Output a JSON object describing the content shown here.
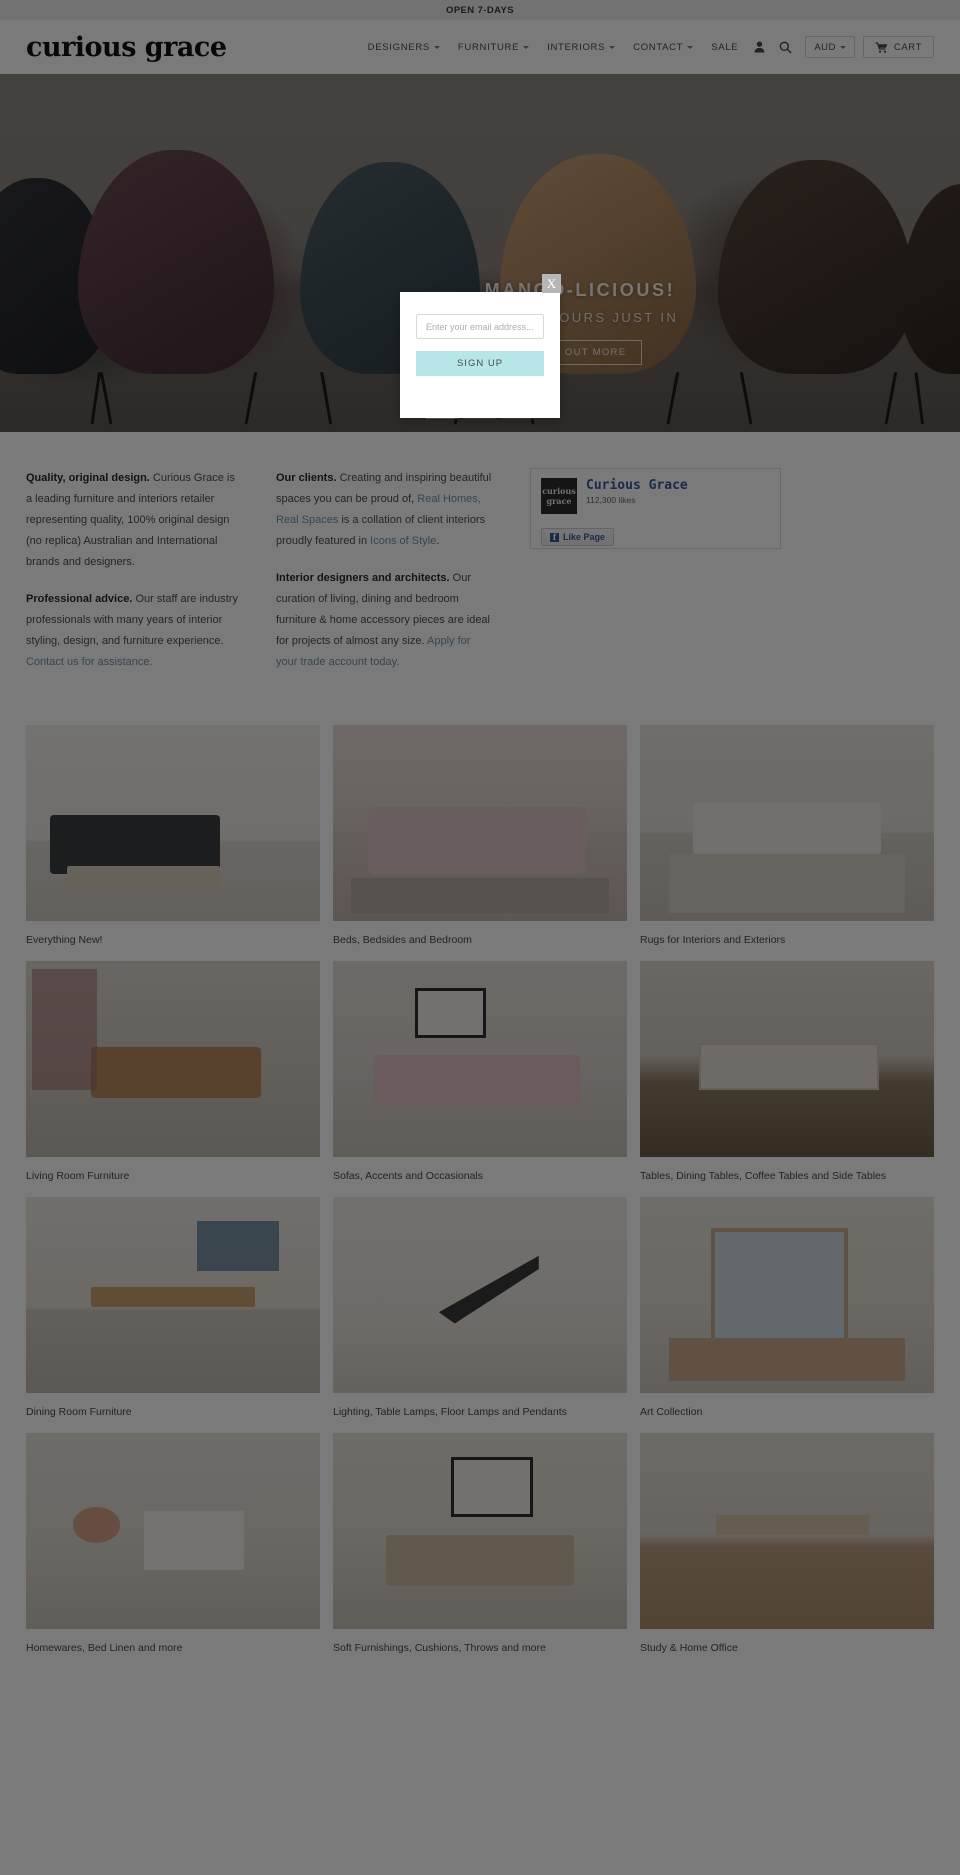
{
  "announcement": {
    "text": "OPEN 7-DAYS"
  },
  "header": {
    "logo": "curious grace",
    "nav": [
      {
        "label": "DESIGNERS",
        "has_dropdown": true
      },
      {
        "label": "FURNITURE",
        "has_dropdown": true
      },
      {
        "label": "INTERIORS",
        "has_dropdown": true
      },
      {
        "label": "CONTACT",
        "has_dropdown": true
      },
      {
        "label": "SALE",
        "has_dropdown": false
      }
    ],
    "account_icon": "user-icon",
    "search_icon": "search-icon",
    "currency": "AUD",
    "cart_label": "CART",
    "cart_icon": "cart-icon"
  },
  "hero": {
    "title": "MANGO-LICIOUS!",
    "subtitle": "NEW COLOURS JUST IN",
    "cta": "FIND OUT MORE",
    "slides": 3,
    "active_slide": 1
  },
  "intro": {
    "col1": {
      "p1_bold": "Quality, original design.",
      "p1_text": " Curious Grace is a leading furniture and interiors retailer representing quality, 100% original design (no replica) Australian and International brands and designers.",
      "p2_bold": "Professional advice.",
      "p2_text": " Our staff are industry professionals with many years of interior styling, design, and furniture experience. ",
      "p2_link": "Contact us for assistance."
    },
    "col2": {
      "p1_bold": "Our clients.",
      "p1_text_a": " Creating and inspiring beautiful spaces you can be proud of, ",
      "p1_link_a": "Real Homes, Real Spaces",
      "p1_text_b": " is a collation of client interiors proudly featured in ",
      "p1_link_b": "Icons of Style",
      "p1_text_c": ".",
      "p2_bold": "Interior designers and architects.",
      "p2_text": " Our curation of living, dining and bedroom furniture & home accessory pieces are ideal for projects of almost any size. ",
      "p2_link": "Apply for your trade account today."
    }
  },
  "facebook": {
    "page_name": "Curious Grace",
    "likes": "112,300 likes",
    "like_button": "Like Page",
    "logo_line1": "curious",
    "logo_line2": "grace",
    "brand_color": "#3b5998"
  },
  "categories": [
    {
      "label": "Everything New!"
    },
    {
      "label": "Beds, Bedsides and Bedroom"
    },
    {
      "label": "Rugs for Interiors and Exteriors"
    },
    {
      "label": "Living Room Furniture"
    },
    {
      "label": "Sofas, Accents and Occasionals"
    },
    {
      "label": "Tables, Dining Tables, Coffee Tables and Side Tables"
    },
    {
      "label": "Dining Room Furniture"
    },
    {
      "label": "Lighting, Table Lamps, Floor Lamps and Pendants"
    },
    {
      "label": "Art Collection"
    },
    {
      "label": "Homewares, Bed Linen and more"
    },
    {
      "label": "Soft Furnishings, Cushions, Throws and more"
    },
    {
      "label": "Study & Home Office"
    }
  ],
  "modal": {
    "close_label": "X",
    "email_placeholder": "Enter your email address...",
    "email_value": "",
    "signup_label": "SIGN UP",
    "button_color": "#b7e6e8"
  }
}
